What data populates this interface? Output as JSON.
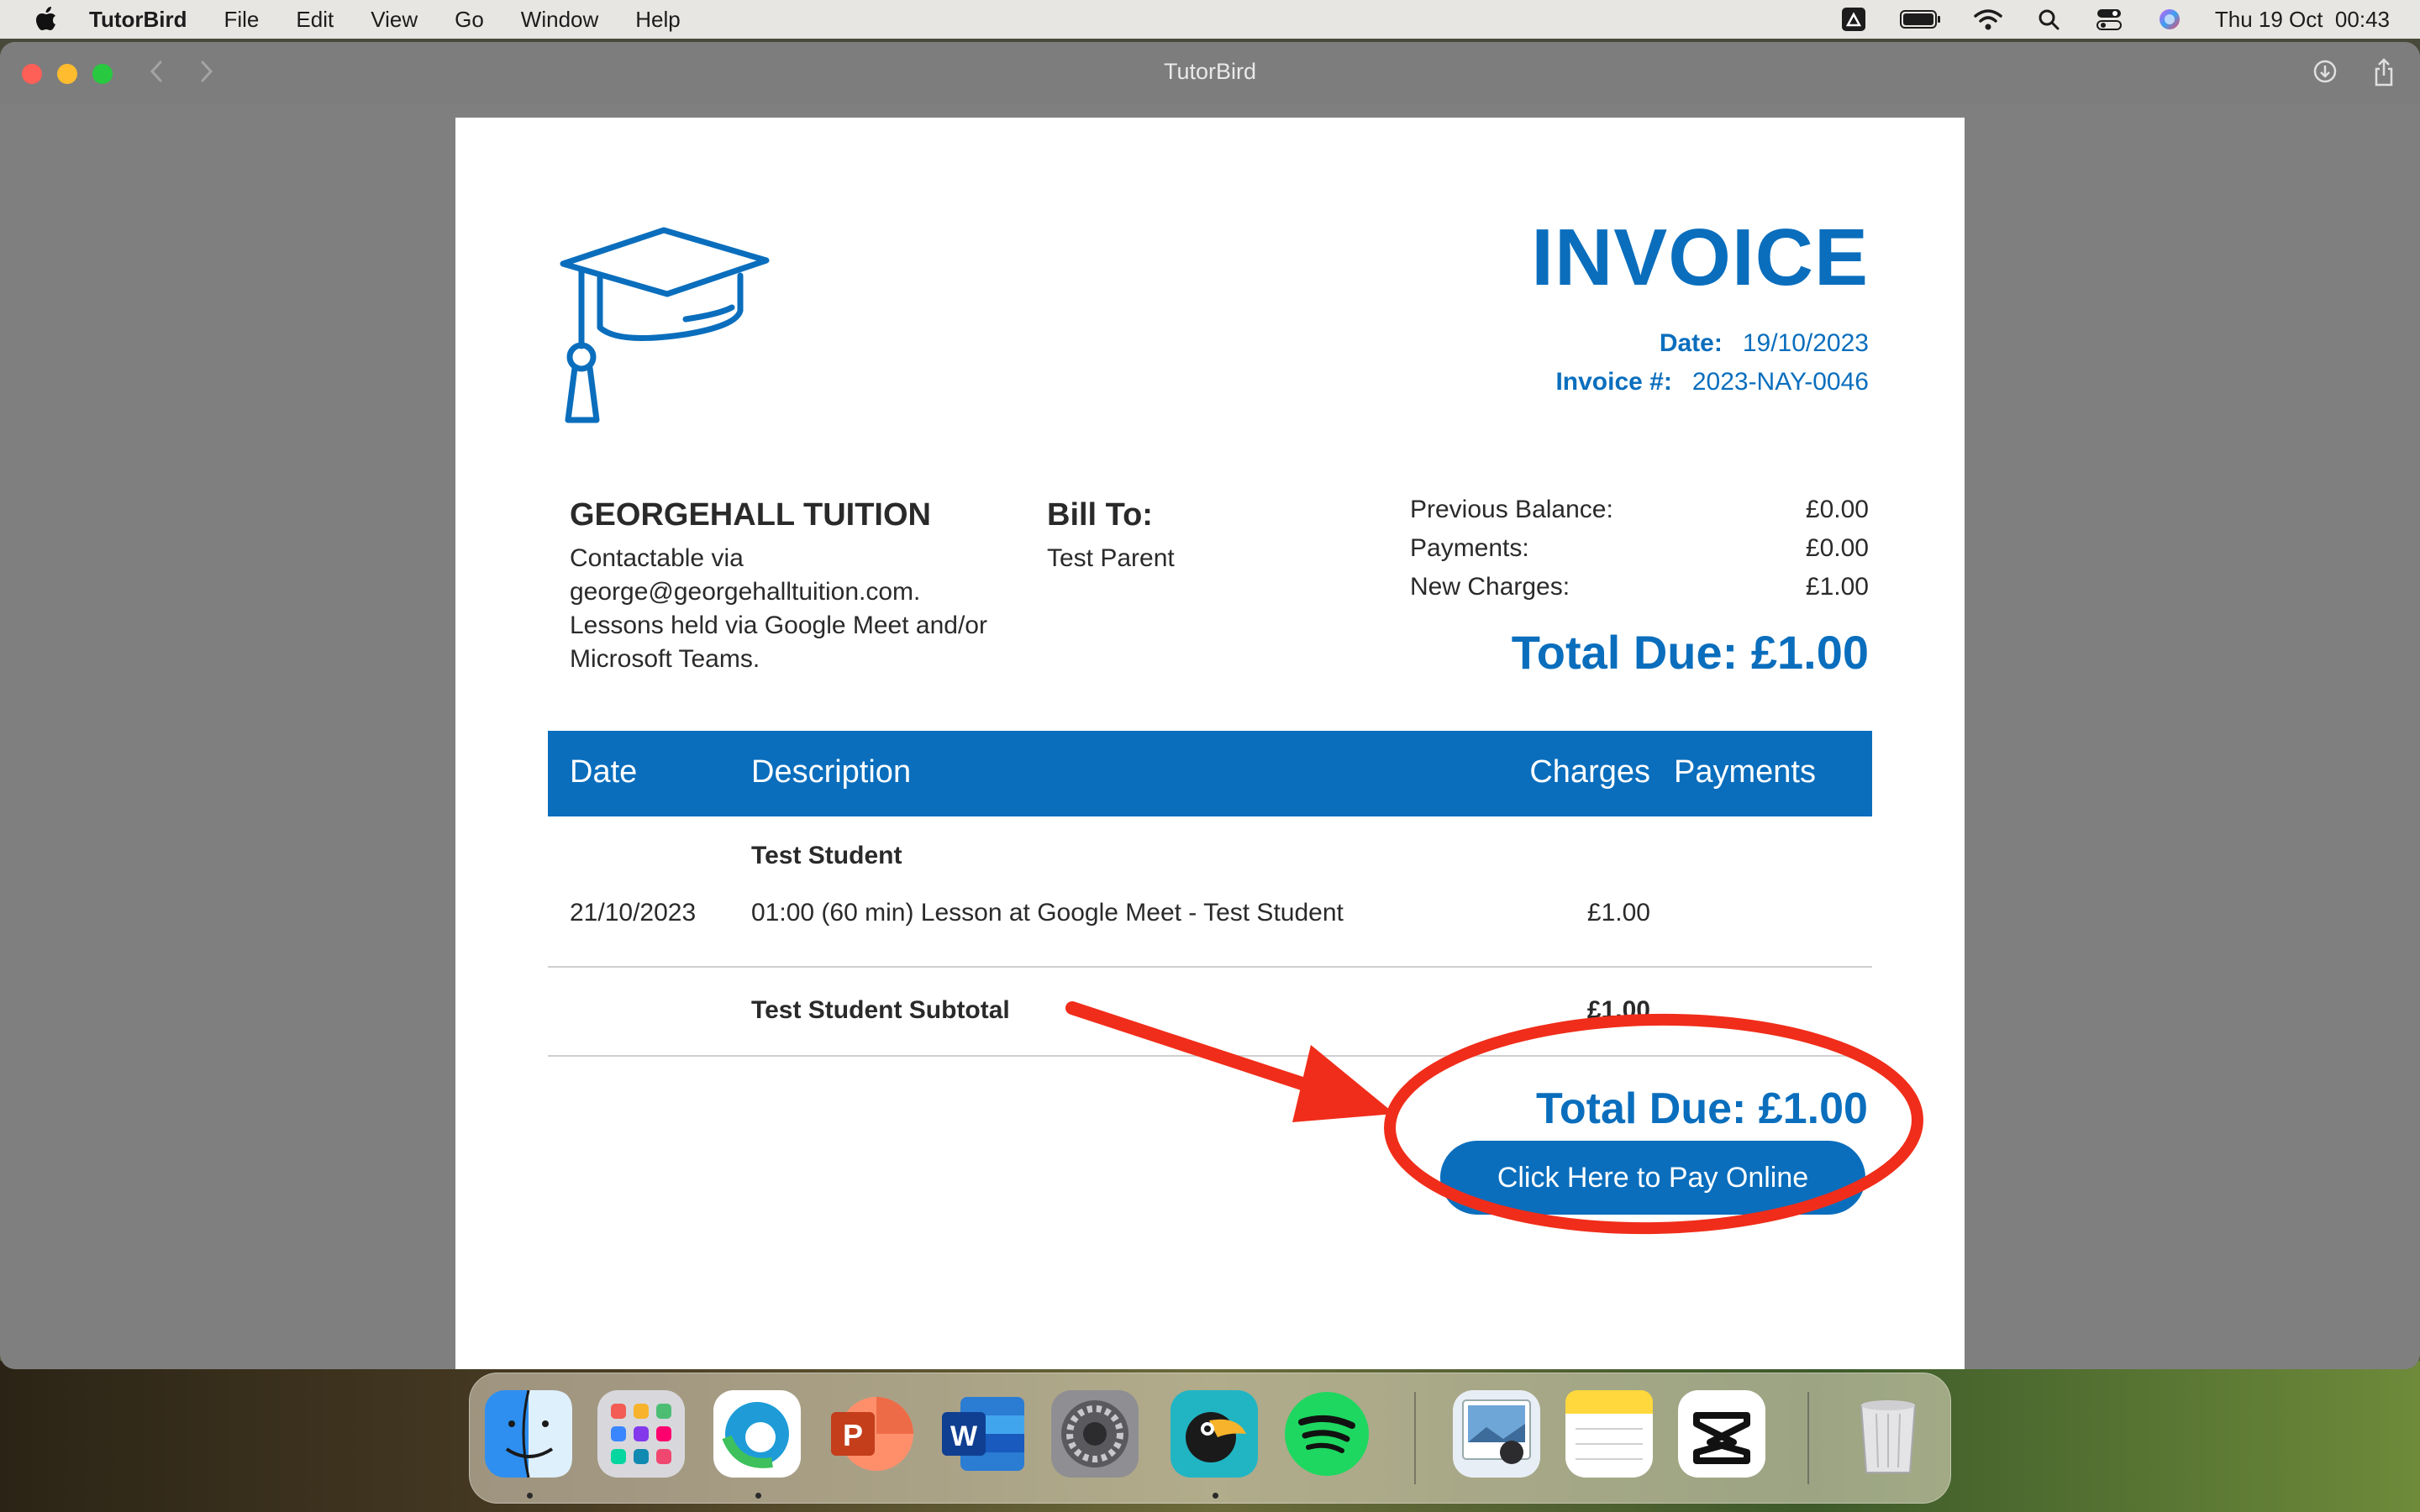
{
  "menubar": {
    "app_name": "TutorBird",
    "items": [
      "File",
      "Edit",
      "View",
      "Go",
      "Window",
      "Help"
    ],
    "clock": "Thu 19 Oct  00:43"
  },
  "window": {
    "title": "TutorBird"
  },
  "invoice": {
    "heading": "INVOICE",
    "date_label": "Date:",
    "date_value": "19/10/2023",
    "number_label": "Invoice #:",
    "number_value": "2023-NAY-0046",
    "company_name": "GEORGEHALL TUITION",
    "company_desc_1": "Contactable via",
    "company_desc_2": "george@georgehalltuition.com.",
    "company_desc_3": "Lessons held via Google Meet and/or",
    "company_desc_4": "Microsoft Teams.",
    "bill_to_label": "Bill To:",
    "bill_to_value": "Test Parent",
    "previous_balance_label": "Previous Balance:",
    "previous_balance_value": "£0.00",
    "payments_label": "Payments:",
    "payments_value": "£0.00",
    "new_charges_label": "New Charges:",
    "new_charges_value": "£1.00",
    "total_due": "Total Due: £1.00",
    "table": {
      "headers": [
        "Date",
        "Description",
        "Charges",
        "Payments"
      ],
      "group": "Test Student",
      "rows": [
        {
          "date": "21/10/2023",
          "description": "01:00 (60 min) Lesson at Google Meet - Test Student",
          "charges": "£1.00",
          "payments": ""
        }
      ],
      "subtotal_label": "Test Student Subtotal",
      "subtotal_value": "£1.00"
    },
    "bottom_total": "Total Due: £1.00",
    "pay_button": "Click Here to Pay Online"
  },
  "colors": {
    "brand_blue": "#0a6ebd",
    "annotation_red": "#f02d1a"
  },
  "dock": {
    "apps": [
      "finder-icon",
      "launchpad-icon",
      "edge-icon",
      "powerpoint-icon",
      "word-icon",
      "system-settings-icon",
      "tutorbird-icon",
      "spotify-icon",
      "preview-icon",
      "notes-icon",
      "capcut-icon",
      "trash-icon"
    ]
  }
}
